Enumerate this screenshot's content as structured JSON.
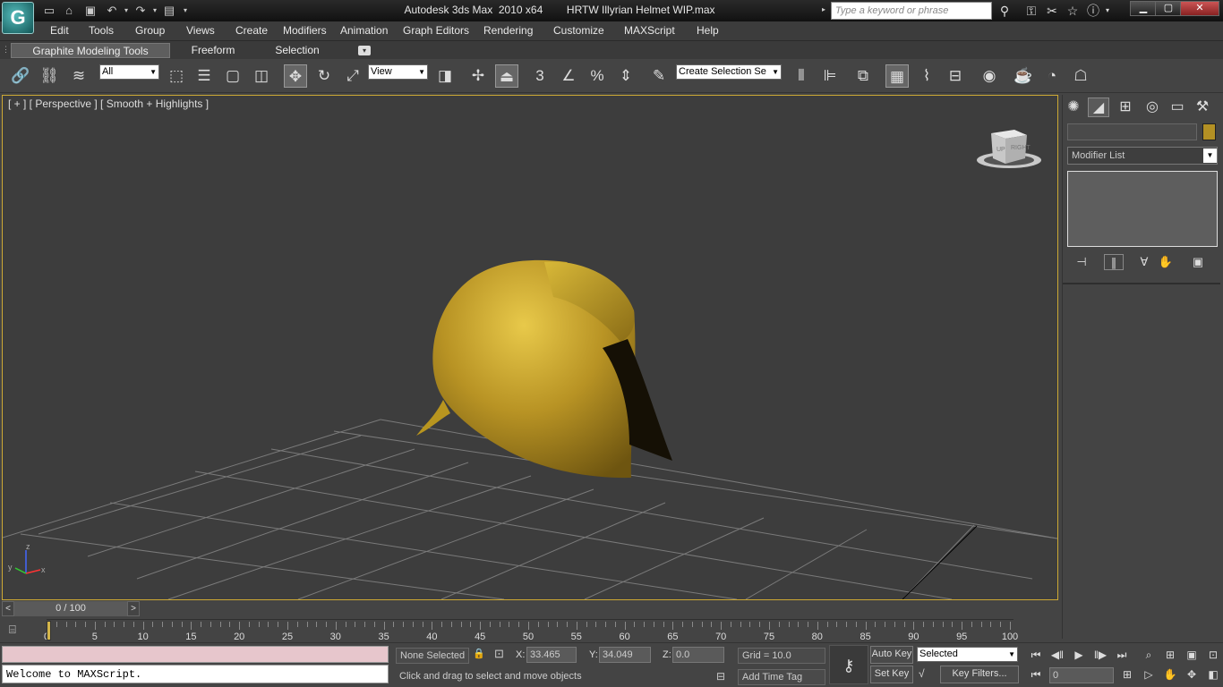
{
  "window": {
    "title": "Autodesk 3ds Max  2010 x64        HRTW Illyrian Helmet WIP.max",
    "search_placeholder": "Type a keyword or phrase",
    "logo_glyph": "G"
  },
  "menu": [
    "Edit",
    "Tools",
    "Group",
    "Views",
    "Create",
    "Modifiers",
    "Animation",
    "Graph Editors",
    "Rendering",
    "Customize",
    "MAXScript",
    "Help"
  ],
  "ribbon": {
    "tabs": [
      "Graphite Modeling Tools",
      "Freeform",
      "Selection"
    ]
  },
  "toolbar": {
    "filter_select": "All",
    "reference_coord": "View",
    "snap_3": "3",
    "named_selection": "Create Selection Se"
  },
  "viewport": {
    "label": "[ + ] [ Perspective ] [ Smooth + Highlights ]",
    "viewcube_top": "UP",
    "viewcube_right": "RIGHT",
    "axis_x": "x",
    "axis_y": "y",
    "axis_z": "z"
  },
  "command_panel": {
    "modifier_list": "Modifier List",
    "object_color": "#b39024"
  },
  "time_slider": {
    "label": "0 / 100",
    "current_frame": 0,
    "total_frames": 100
  },
  "track_bar": {
    "labels": [
      "0",
      "5",
      "10",
      "15",
      "20",
      "25",
      "30",
      "35",
      "40",
      "45",
      "50",
      "55",
      "60",
      "65",
      "70",
      "75",
      "80",
      "85",
      "90",
      "95",
      "100"
    ]
  },
  "status": {
    "listener_output": "Welcome to MAXScript.",
    "selection": "None Selected",
    "prompt": "Click and drag to select and move objects",
    "x_label": "X:",
    "x_value": "33.465",
    "y_label": "Y:",
    "y_value": "34.049",
    "z_label": "Z:",
    "z_value": "0.0",
    "grid": "Grid = 10.0",
    "add_time_tag": "Add Time Tag",
    "auto_key": "Auto Key",
    "set_key": "Set Key",
    "key_mode": "Selected",
    "key_filters": "Key Filters...",
    "frame_field": "0"
  },
  "colors": {
    "viewport_border": "#cda934",
    "helmet_gold": "#c8a42a"
  }
}
